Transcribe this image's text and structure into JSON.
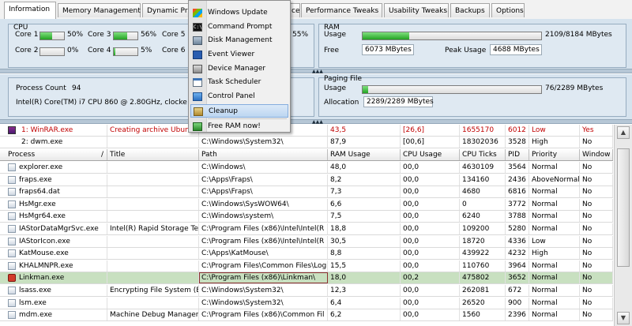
{
  "tabs": [
    "Information",
    "Memory Management",
    "Dynamic Pri",
    "ce",
    "Performance Tweaks",
    "Usability Tweaks",
    "Backups",
    "Options"
  ],
  "cpu": {
    "title": "CPU",
    "cores": [
      {
        "label": "Core 1",
        "pct": "50%",
        "value": 0.5
      },
      {
        "label": "Core 3",
        "pct": "56%",
        "value": 0.56
      },
      {
        "label": "Core 5",
        "pct": "",
        "value": 0
      },
      {
        "label": "Core 2",
        "pct": "0%",
        "value": 0.0
      },
      {
        "label": "Core 4",
        "pct": "5%",
        "value": 0.05
      },
      {
        "label": "Core 6",
        "pct": "",
        "value": 0
      },
      {
        "label": "",
        "pct": "55%",
        "value": 0
      }
    ]
  },
  "ram": {
    "title": "RAM",
    "usage_label": "Usage",
    "usage_value": "2109/8184 MBytes",
    "usage_fraction": 0.26,
    "free_label": "Free",
    "free_value": "6073 MBytes",
    "peak_label": "Peak Usage",
    "peak_value": "4688 MBytes"
  },
  "info": {
    "process_count_label": "Process Count",
    "process_count": "94",
    "cpu_name": "Intel(R) Core(TM) i7 CPU 860 @ 2.80GHz, clocke"
  },
  "paging": {
    "title": "Paging File",
    "usage_label": "Usage",
    "usage_value": "76/2289 MBytes",
    "usage_fraction": 0.033,
    "alloc_label": "Allocation",
    "alloc_value": "2289/2289 MBytes"
  },
  "menu": {
    "items": [
      {
        "label": "Windows Update",
        "icon": "windows-update-icon"
      },
      {
        "label": "Command Prompt",
        "icon": "command-prompt-icon"
      },
      {
        "label": "Disk Management",
        "icon": "disk-management-icon"
      },
      {
        "label": "Event Viewer",
        "icon": "event-viewer-icon"
      },
      {
        "label": "Device Manager",
        "icon": "device-manager-icon"
      },
      {
        "label": "Task Scheduler",
        "icon": "task-scheduler-icon"
      },
      {
        "label": "Control Panel",
        "icon": "control-panel-icon"
      },
      {
        "label": "Cleanup",
        "icon": "cleanup-icon"
      },
      {
        "label": "Free RAM now!",
        "icon": "free-ram-icon"
      }
    ]
  },
  "top_processes": [
    {
      "name": "1: WinRAR.exe",
      "title": "Creating archive Ubun",
      "path": "",
      "ram": "43,5",
      "cpu": "[26,6]",
      "ticks": "1655170",
      "pid": "6012",
      "priority": "Low",
      "window": "Yes"
    },
    {
      "name": "2: dwm.exe",
      "title": "",
      "path": "C:\\Windows\\System32\\",
      "ram": "87,9",
      "cpu": "[00,6]",
      "ticks": "18302036",
      "pid": "3528",
      "priority": "High",
      "window": "No"
    }
  ],
  "table": {
    "columns": [
      "Process",
      "Title",
      "Path",
      "RAM Usage",
      "CPU Usage",
      "CPU Ticks",
      "PID",
      "Priority",
      "Window"
    ],
    "sort_indicator": "/",
    "rows": [
      {
        "name": "explorer.exe",
        "title": "",
        "path": "C:\\Windows\\",
        "ram": "48,0",
        "cpu": "00,0",
        "ticks": "4630109",
        "pid": "3564",
        "priority": "Normal",
        "window": "No"
      },
      {
        "name": "fraps.exe",
        "title": "",
        "path": "C:\\Apps\\Fraps\\",
        "ram": "8,2",
        "cpu": "00,0",
        "ticks": "134160",
        "pid": "2436",
        "priority": "AboveNormal",
        "window": "No"
      },
      {
        "name": "fraps64.dat",
        "title": "",
        "path": "C:\\Apps\\Fraps\\",
        "ram": "7,3",
        "cpu": "00,0",
        "ticks": "4680",
        "pid": "6816",
        "priority": "Normal",
        "window": "No"
      },
      {
        "name": "HsMgr.exe",
        "title": "",
        "path": "C:\\Windows\\SysWOW64\\",
        "ram": "6,6",
        "cpu": "00,0",
        "ticks": "0",
        "pid": "3772",
        "priority": "Normal",
        "window": "No"
      },
      {
        "name": "HsMgr64.exe",
        "title": "",
        "path": "C:\\Windows\\system\\",
        "ram": "7,5",
        "cpu": "00,0",
        "ticks": "6240",
        "pid": "3788",
        "priority": "Normal",
        "window": "No"
      },
      {
        "name": "IAStorDataMgrSvc.exe",
        "title": "Intel(R) Rapid Storage Te",
        "path": "C:\\Program Files (x86)\\Intel\\Intel(R",
        "ram": "18,8",
        "cpu": "00,0",
        "ticks": "109200",
        "pid": "5280",
        "priority": "Normal",
        "window": "No"
      },
      {
        "name": "IAStorIcon.exe",
        "title": "",
        "path": "C:\\Program Files (x86)\\Intel\\Intel(R",
        "ram": "30,5",
        "cpu": "00,0",
        "ticks": "18720",
        "pid": "4336",
        "priority": "Low",
        "window": "No"
      },
      {
        "name": "KatMouse.exe",
        "title": "",
        "path": "C:\\Apps\\KatMouse\\",
        "ram": "8,8",
        "cpu": "00,0",
        "ticks": "439922",
        "pid": "4232",
        "priority": "High",
        "window": "No"
      },
      {
        "name": "KHALMNPR.exe",
        "title": "",
        "path": "C:\\Program Files\\Common Files\\Log",
        "ram": "15,5",
        "cpu": "00,0",
        "ticks": "110760",
        "pid": "3964",
        "priority": "Normal",
        "window": "No"
      },
      {
        "name": "Linkman.exe",
        "title": "",
        "path": "C:\\Program Files (x86)\\Linkman\\",
        "ram": "18,0",
        "cpu": "00,2",
        "ticks": "475802",
        "pid": "3652",
        "priority": "Normal",
        "window": "No"
      },
      {
        "name": "lsass.exe",
        "title": "Encrypting File System (E",
        "path": "C:\\Windows\\System32\\",
        "ram": "12,3",
        "cpu": "00,0",
        "ticks": "262081",
        "pid": "672",
        "priority": "Normal",
        "window": "No"
      },
      {
        "name": "lsm.exe",
        "title": "",
        "path": "C:\\Windows\\System32\\",
        "ram": "6,4",
        "cpu": "00,0",
        "ticks": "26520",
        "pid": "900",
        "priority": "Normal",
        "window": "No"
      },
      {
        "name": "mdm.exe",
        "title": "Machine Debug Manager",
        "path": "C:\\Program Files (x86)\\Common Fil",
        "ram": "6,2",
        "cpu": "00,0",
        "ticks": "1560",
        "pid": "2396",
        "priority": "Normal",
        "window": "No"
      }
    ]
  },
  "colors": {
    "selected_row": "#c8e0c0",
    "top_process_text": "#c00000",
    "bar_fill": "#23a323",
    "panel_bg": "#d6e3ee"
  }
}
